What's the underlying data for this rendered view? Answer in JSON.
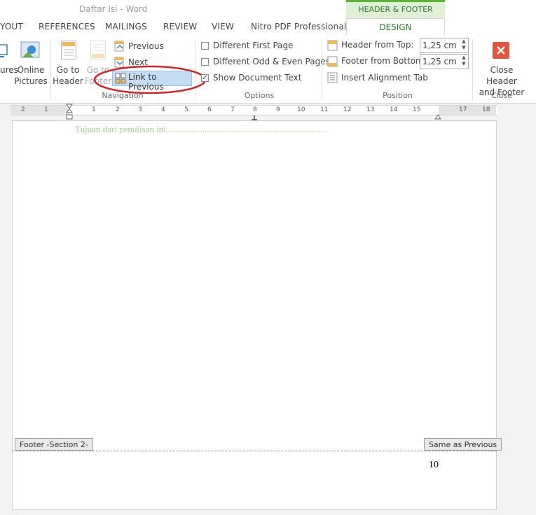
{
  "window": {
    "title": "Daftar Isi - Word",
    "context_tab_group": "HEADER & FOOTER TOOLS"
  },
  "tabs": [
    {
      "label": "YOUT"
    },
    {
      "label": "REFERENCES"
    },
    {
      "label": "MAILINGS"
    },
    {
      "label": "REVIEW"
    },
    {
      "label": "VIEW"
    },
    {
      "label": "Nitro PDF Professional"
    },
    {
      "label": "DESIGN"
    }
  ],
  "ribbon": {
    "insert": {
      "pictures_partial": "ures",
      "online_pictures": [
        "Online",
        "Pictures"
      ]
    },
    "navigation": {
      "go_to_header": [
        "Go to",
        "Header"
      ],
      "go_to_footer": [
        "Go to",
        "Footer"
      ],
      "previous": "Previous",
      "next": "Next",
      "link_to_previous": "Link to Previous",
      "group_label": "Navigation"
    },
    "options": {
      "different_first_page": "Different First Page",
      "different_odd_even": "Different Odd & Even Pages",
      "show_document_text": "Show Document Text",
      "group_label": "Options"
    },
    "position": {
      "header_from_top_label": "Header from Top:",
      "header_from_top_value": "1,25 cm",
      "footer_from_bottom_label": "Footer from Bottom:",
      "footer_from_bottom_value": "1,25 cm",
      "insert_alignment_tab": "Insert Alignment Tab",
      "group_label": "Position"
    },
    "close": {
      "label": [
        "Close Header",
        "and Footer"
      ],
      "group_label": "Close"
    }
  },
  "ruler": {
    "marks": [
      "2",
      "1",
      "1",
      "2",
      "3",
      "4",
      "5",
      "6",
      "7",
      "8",
      "9",
      "10",
      "11",
      "12",
      "13",
      "14",
      "15",
      "17",
      "18"
    ]
  },
  "document": {
    "toc_line": "Tujuan dari penulisan ini.......................................................................",
    "footer_tag": "Footer -Section 2-",
    "same_as_previous_tag": "Same as Previous",
    "page_number": "10"
  },
  "colors": {
    "accent_green": "#2e7d32",
    "highlight_blue": "#c5dcf5",
    "annotation_red": "#d2232a",
    "close_red": "#e2553f"
  }
}
